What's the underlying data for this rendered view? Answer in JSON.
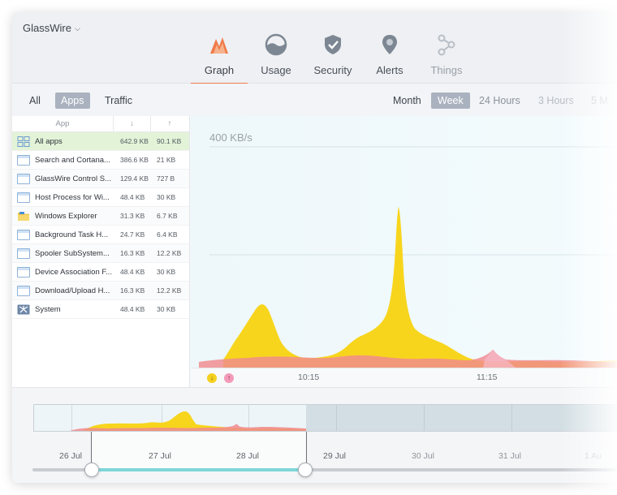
{
  "app": {
    "title": "GlassWire"
  },
  "nav": {
    "items": [
      {
        "label": "Graph",
        "icon": "graph-icon"
      },
      {
        "label": "Usage",
        "icon": "usage-icon"
      },
      {
        "label": "Security",
        "icon": "shield-icon"
      },
      {
        "label": "Alerts",
        "icon": "alert-pin-icon"
      },
      {
        "label": "Things",
        "icon": "things-icon"
      }
    ],
    "active": "Graph"
  },
  "filters": {
    "all": "All",
    "apps": "Apps",
    "traffic": "Traffic",
    "active": "Apps"
  },
  "ranges": {
    "month": "Month",
    "week": "Week",
    "hours24": "24 Hours",
    "hours3": "3 Hours",
    "minutes5": "5 M",
    "active": "Week"
  },
  "table": {
    "headers": {
      "app": "App",
      "download": "↓",
      "upload": "↑"
    },
    "rows": [
      {
        "name": "All apps",
        "down": "642.9 KB",
        "up": "90.1 KB",
        "icon": "all-apps-icon"
      },
      {
        "name": "Search and Cortana...",
        "down": "386.6 KB",
        "up": "21 KB",
        "icon": "window-icon"
      },
      {
        "name": "GlassWire Control S...",
        "down": "129.4 KB",
        "up": "727 B",
        "icon": "window-icon"
      },
      {
        "name": "Host Process for Wi...",
        "down": "48.4 KB",
        "up": "30 KB",
        "icon": "window-icon"
      },
      {
        "name": "Windows Explorer",
        "down": "31.3 KB",
        "up": "6.7 KB",
        "icon": "folder-icon"
      },
      {
        "name": "Background Task H...",
        "down": "24.7 KB",
        "up": "6.4 KB",
        "icon": "window-icon"
      },
      {
        "name": "Spooler SubSystem...",
        "down": "16.3 KB",
        "up": "12.2 KB",
        "icon": "window-icon"
      },
      {
        "name": "Device Association F...",
        "down": "48.4 KB",
        "up": "30 KB",
        "icon": "window-icon"
      },
      {
        "name": "Download/Upload H...",
        "down": "16.3 KB",
        "up": "12.2 KB",
        "icon": "window-icon"
      },
      {
        "name": "System",
        "down": "48.4 KB",
        "up": "30 KB",
        "icon": "system-icon"
      }
    ]
  },
  "graph": {
    "scale_label": "400 KB/s",
    "ticks": [
      "10:15",
      "11:15"
    ],
    "legend": {
      "download": "↓",
      "upload": "↑"
    },
    "colors": {
      "download": "#f7d51d",
      "upload": "#f08a8f",
      "accent": "#f07b4a"
    }
  },
  "timeline": {
    "dates": [
      "26 Jul",
      "27 Jul",
      "28 Jul",
      "29 Jul",
      "30 Jul",
      "31 Jul",
      "1 Au"
    ]
  }
}
